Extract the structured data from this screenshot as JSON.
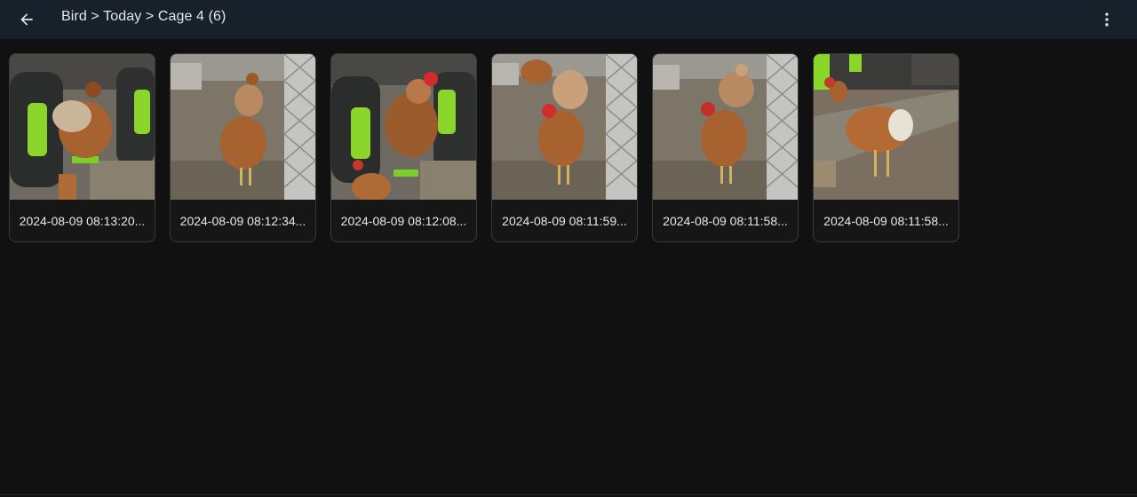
{
  "header": {
    "breadcrumb": "Bird > Today > Cage 4 (6)",
    "back_icon": "arrow-left-icon",
    "menu_icon": "more-vertical-icon"
  },
  "photos": [
    {
      "caption": "2024-08-09 08:13:20..."
    },
    {
      "caption": "2024-08-09 08:12:34..."
    },
    {
      "caption": "2024-08-09 08:12:08..."
    },
    {
      "caption": "2024-08-09 08:11:59..."
    },
    {
      "caption": "2024-08-09 08:11:58..."
    },
    {
      "caption": "2024-08-09 08:11:58..."
    }
  ],
  "colors": {
    "header_bg": "#16212b",
    "page_bg": "#111111",
    "accent_green": "#8bd62a",
    "hen_brown": "#a8622f"
  }
}
